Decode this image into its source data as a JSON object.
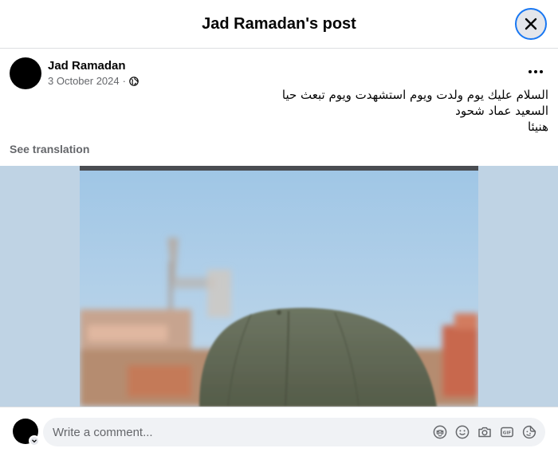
{
  "header": {
    "title": "Jad Ramadan's post"
  },
  "post": {
    "author": "Jad Ramadan",
    "date": "3 October 2024",
    "separator": "·",
    "text_lines": [
      "السلام عليك يوم ولدت ويوم استشهدت ويوم تبعث حيا",
      "السعيد عماد شحود",
      "هنيئا"
    ],
    "see_translation": "See translation"
  },
  "comment": {
    "placeholder": "Write a comment..."
  },
  "icons": {
    "close": "close-icon",
    "privacy": "globe-icon",
    "more": "more-options-icon",
    "comment_actions": [
      "avatar-sticker-icon",
      "emoji-icon",
      "camera-icon",
      "gif-icon",
      "sticker-icon"
    ]
  },
  "colors": {
    "accent": "#1877f2",
    "text_primary": "#050505",
    "text_secondary": "#65676b",
    "input_background": "#f0f2f5"
  }
}
